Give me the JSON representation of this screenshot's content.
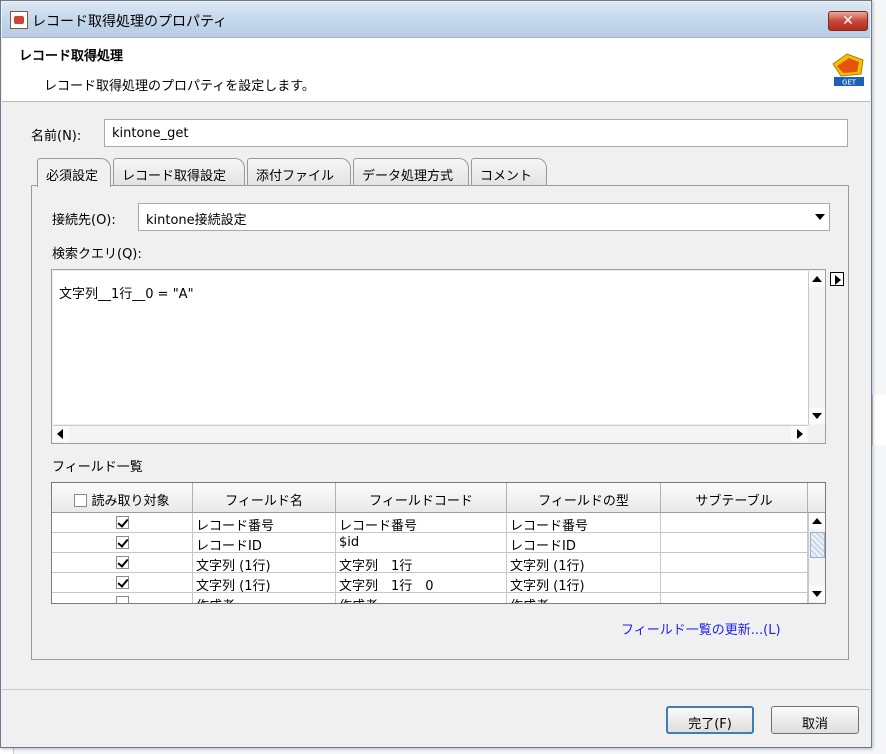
{
  "window": {
    "title": "レコード取得処理のプロパティ",
    "close_glyph": "✕"
  },
  "header": {
    "title": "レコード取得処理",
    "description": "レコード取得処理のプロパティを設定します。",
    "icon": "get-component-icon",
    "icon_badge": "GET"
  },
  "name_field": {
    "label": "名前(N):",
    "value": "kintone_get"
  },
  "tabs": [
    {
      "label": "必須設定",
      "active": true
    },
    {
      "label": "レコード取得設定"
    },
    {
      "label": "添付ファイル"
    },
    {
      "label": "データ処理方式"
    },
    {
      "label": "コメント"
    }
  ],
  "connection": {
    "label": "接続先(O):",
    "value": "kintone接続設定"
  },
  "query": {
    "label": "検索クエリ(Q):",
    "value": "文字列__1行__0 = \"A\""
  },
  "fields": {
    "label": "フィールド一覧",
    "columns": [
      "読み取り対象",
      "フィールド名",
      "フィールドコード",
      "フィールドの型",
      "サブテーブル"
    ],
    "rows": [
      {
        "checked": true,
        "name": "レコード番号",
        "code": "レコード番号",
        "type": "レコード番号",
        "subtable": ""
      },
      {
        "checked": true,
        "name": "レコードID",
        "code": "$id",
        "type": "レコードID",
        "subtable": ""
      },
      {
        "checked": true,
        "name": "文字列 (1行)",
        "code": "文字列__1行_",
        "type": "文字列 (1行)",
        "subtable": ""
      },
      {
        "checked": true,
        "name": "文字列 (1行)",
        "code": "文字列__1行__0",
        "type": "文字列 (1行)",
        "subtable": ""
      },
      {
        "checked": false,
        "name": "作成者",
        "code": "作成者",
        "type": "作成者",
        "subtable": ""
      }
    ],
    "refresh_link": "フィールド一覧の更新...(L)"
  },
  "buttons": {
    "ok": "完了(F)",
    "cancel": "取消"
  },
  "colors": {
    "link": "#2222ee",
    "title_bar": "#c3d6ea",
    "close": "#c8483a",
    "default_button_border": "#3c7fb1"
  }
}
